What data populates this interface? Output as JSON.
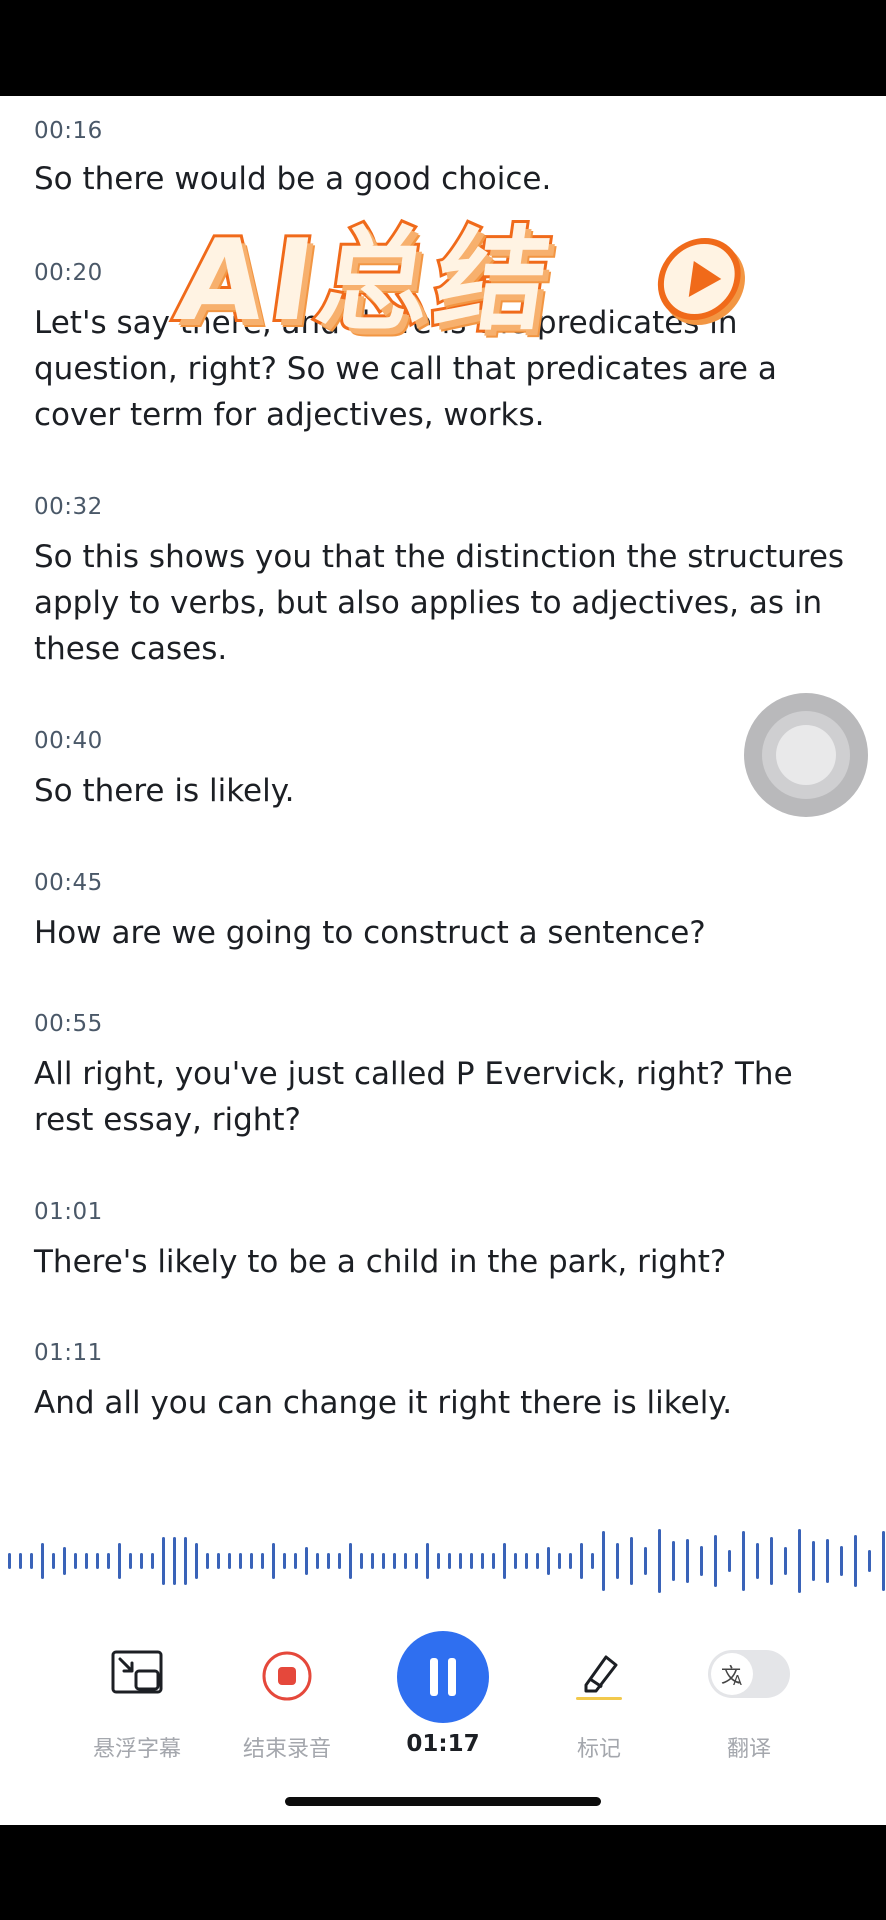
{
  "transcript": [
    {
      "time": "00:16",
      "text": "So there would be a good choice."
    },
    {
      "time": "00:20",
      "text": "Let's say there, and there is the predicates in question, right? So we call that predicates are a cover term for adjectives, works."
    },
    {
      "time": "00:32",
      "text": "So this shows you that the distinction the structures apply to verbs, but also applies to adjectives, as in these cases."
    },
    {
      "time": "00:40",
      "text": "So there is likely."
    },
    {
      "time": "00:45",
      "text": "How are we going to construct a sentence?"
    },
    {
      "time": "00:55",
      "text": "All right, you've just called P Evervick, right? The rest essay, right?"
    },
    {
      "time": "01:01",
      "text": "There's likely to be a child in the park, right?"
    },
    {
      "time": "01:11",
      "text": "And all you can change it right there is likely."
    }
  ],
  "overlay": {
    "title": "AI总结"
  },
  "controls": {
    "floating_subtitle": "悬浮字幕",
    "end_recording": "结束录音",
    "elapsed": "01:17",
    "mark": "标记",
    "translate": "翻译"
  },
  "colors": {
    "accent_blue": "#2f6ff0",
    "record_red": "#e5483b",
    "overlay_orange": "#f06a1a",
    "wave_blue": "#3a63b8"
  }
}
